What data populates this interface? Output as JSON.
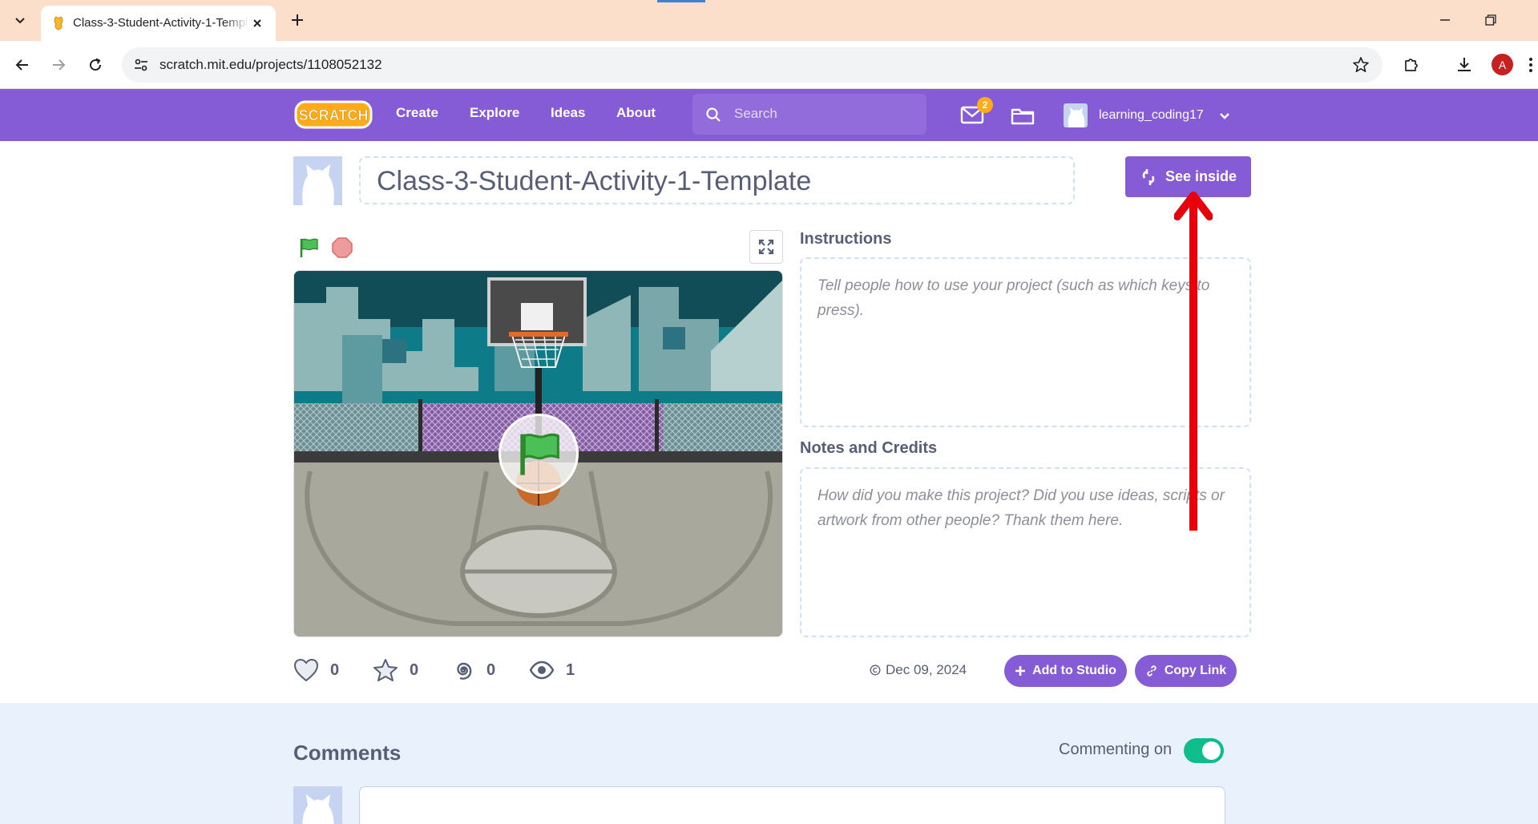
{
  "browser": {
    "tab_title": "Class-3-Student-Activity-1-Template",
    "url": "scratch.mit.edu/projects/1108052132",
    "profile_initial": "A"
  },
  "nav": {
    "links": [
      "Create",
      "Explore",
      "Ideas",
      "About"
    ],
    "search_placeholder": "Search",
    "message_count": "2",
    "username": "learning_coding17",
    "logo_text": "SCRATCH"
  },
  "project": {
    "title": "Class-3-Student-Activity-1-Template",
    "see_inside_label": "See inside",
    "instructions_label": "Instructions",
    "instructions_placeholder": "Tell people how to use your project (such as which keys to press).",
    "notes_label": "Notes and Credits",
    "notes_placeholder": "How did you make this project? Did you use ideas, scripts or artwork from other people? Thank them here.",
    "stats": {
      "loves": "0",
      "favorites": "0",
      "remixes": "0",
      "views": "1"
    },
    "date": "Dec 09, 2024",
    "add_to_studio_label": "Add to Studio",
    "copy_link_label": "Copy Link"
  },
  "comments": {
    "title": "Comments",
    "commenting_label": "Commenting on",
    "commenting_enabled": true
  },
  "colors": {
    "scratch_purple": "#855cd6",
    "toggle_green": "#0fbd8c",
    "annotation_red": "#e8000b",
    "tab_strip": "#fcdfcb"
  }
}
